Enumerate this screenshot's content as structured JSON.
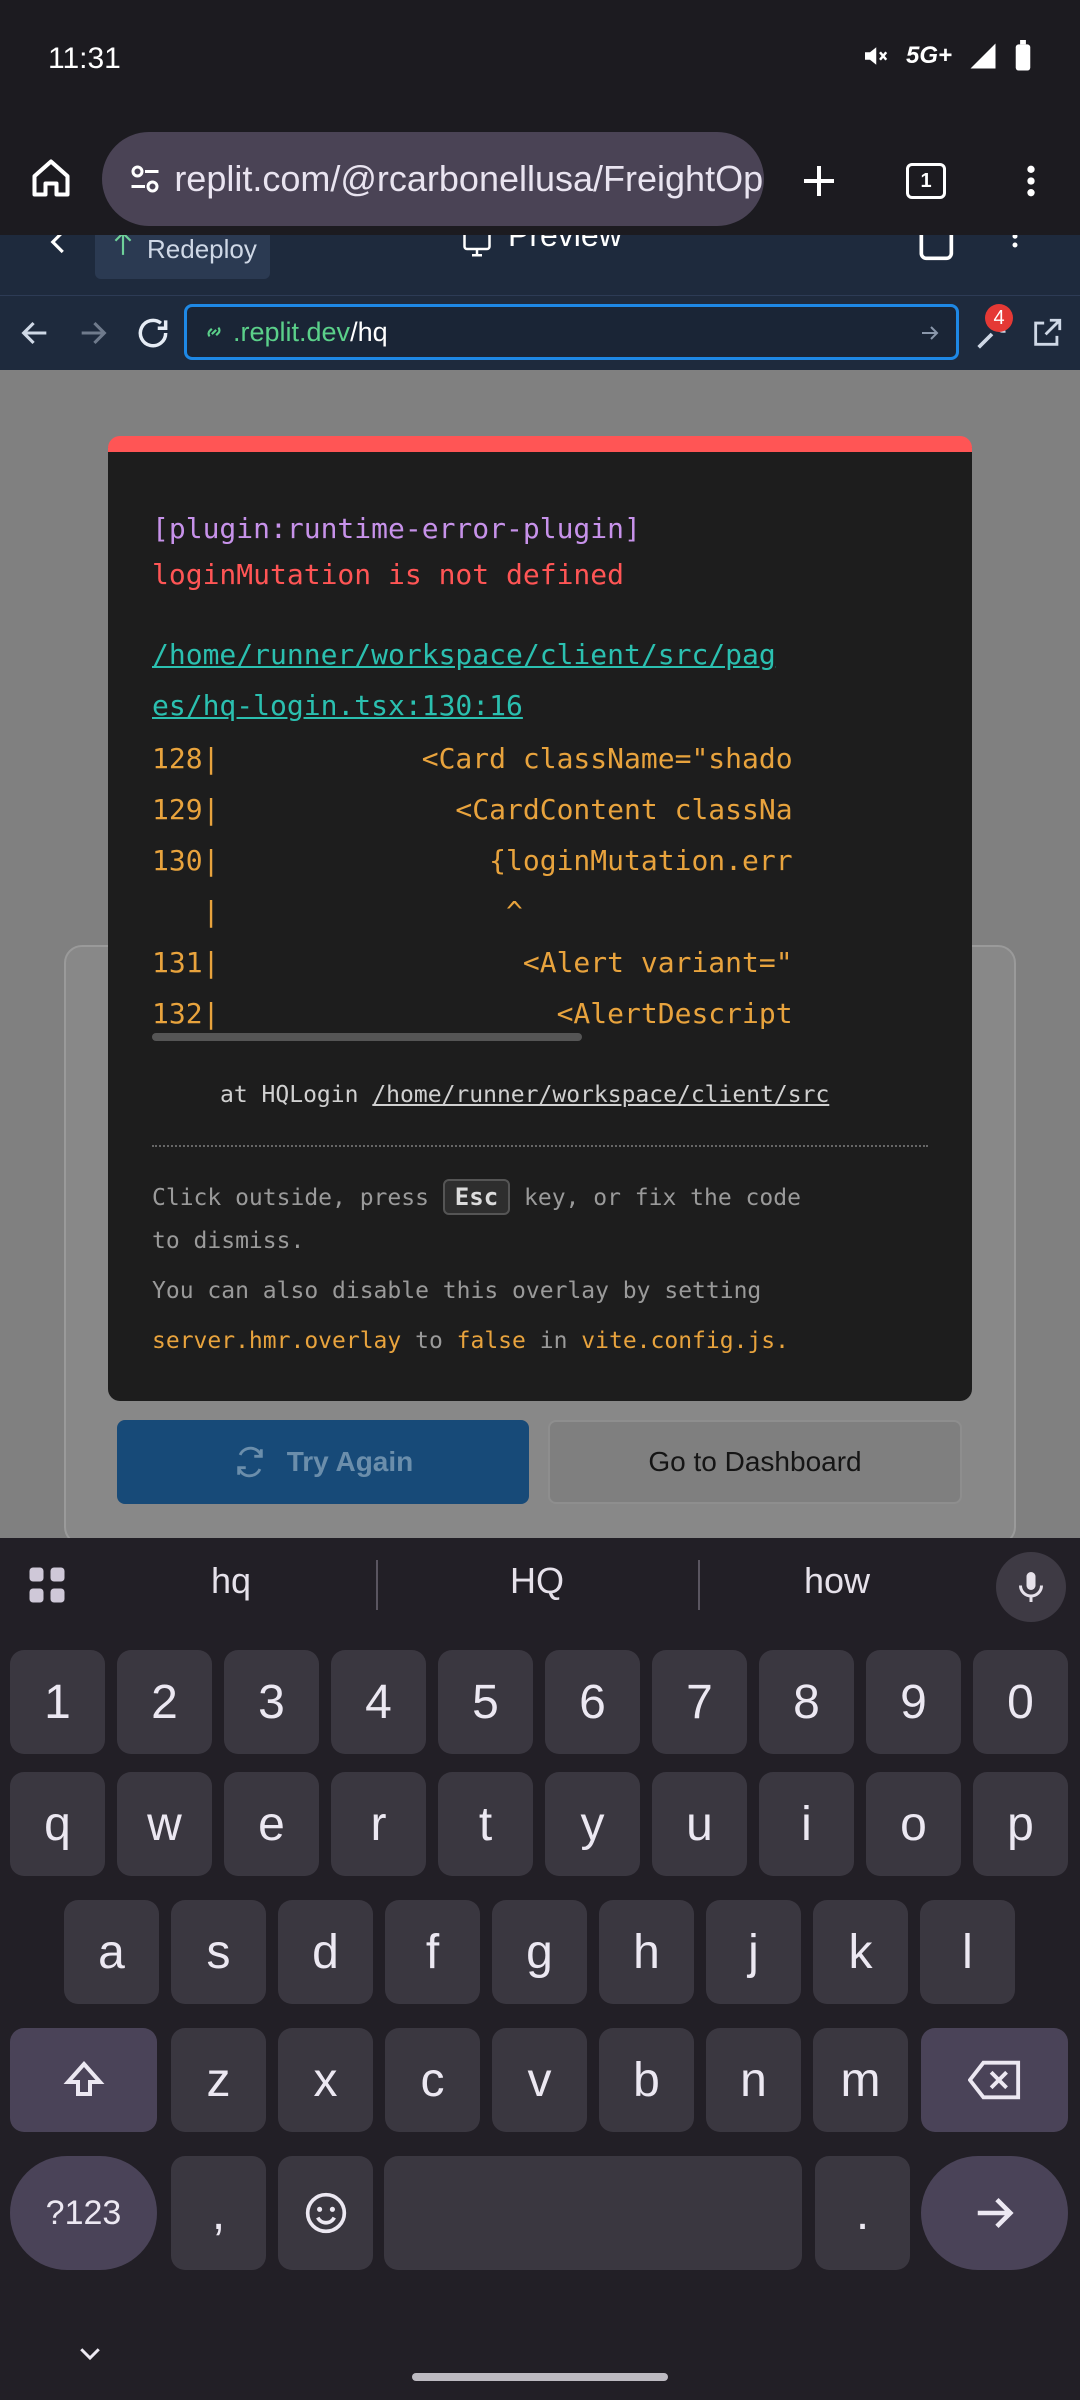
{
  "status": {
    "time": "11:31",
    "network": "5G+"
  },
  "browser": {
    "url": "replit.com/@rcarbonellusa/FreightOps",
    "tab_count": "1"
  },
  "replit": {
    "redeploy_label": "Redeploy",
    "preview_label": "Preview",
    "address_domain": ".replit.dev",
    "address_path": "/hq",
    "badge_count": "4"
  },
  "page": {
    "try_again_label": "Try Again",
    "dashboard_label": "Go to Dashboard"
  },
  "error": {
    "plugin": "[plugin:runtime-error-plugin]",
    "message": "loginMutation is not defined",
    "file_line1": "/home/runner/workspace/client/src/pag",
    "file_line2": "es/hq-login.tsx:130:16",
    "code_lines": [
      "128|            <Card className=\"shado",
      "129|              <CardContent classNa",
      "130|                {loginMutation.err",
      "   |                 ^",
      "131|                  <Alert variant=\"",
      "132|                    <AlertDescript"
    ],
    "stack_prefix": "at HQLogin ",
    "stack_path": "/home/runner/workspace/client/src",
    "tip_line1_a": "Click outside, press ",
    "tip_esc": "Esc",
    "tip_line1_b": " key, or fix the code",
    "tip_line2": "to dismiss.",
    "tip_line3": "You can also disable this overlay by setting",
    "tip_line4_code": "server.hmr.overlay",
    "tip_line4_mid": " to ",
    "tip_line4_false": "false",
    "tip_line4_in": " in ",
    "tip_line4_file": "vite.config.js."
  },
  "keyboard": {
    "suggestions": [
      "hq",
      "HQ",
      "how"
    ],
    "row_numbers": [
      "1",
      "2",
      "3",
      "4",
      "5",
      "6",
      "7",
      "8",
      "9",
      "0"
    ],
    "row1": [
      "q",
      "w",
      "e",
      "r",
      "t",
      "y",
      "u",
      "i",
      "o",
      "p"
    ],
    "row2": [
      "a",
      "s",
      "d",
      "f",
      "g",
      "h",
      "j",
      "k",
      "l"
    ],
    "row3": [
      "z",
      "x",
      "c",
      "v",
      "b",
      "n",
      "m"
    ],
    "symbols_label": "?123",
    "comma": ",",
    "period": "."
  }
}
